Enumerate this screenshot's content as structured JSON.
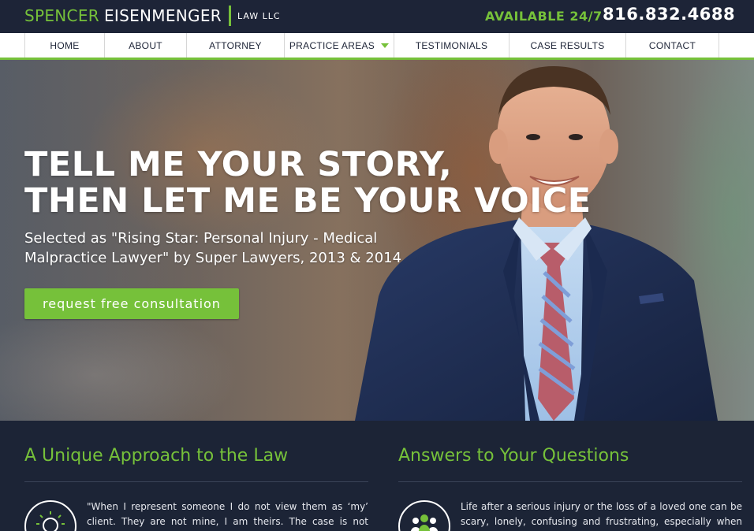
{
  "header": {
    "logo_first": "SPENCER",
    "logo_last": "EISENMENGER",
    "logo_suffix": "LAW LLC",
    "availability": "AVAILABLE 24/7",
    "phone": "816.832.4688"
  },
  "nav": {
    "items": [
      {
        "label": "HOME"
      },
      {
        "label": "ABOUT"
      },
      {
        "label": "ATTORNEY"
      },
      {
        "label": "PRACTICE AREAS"
      },
      {
        "label": "TESTIMONIALS"
      },
      {
        "label": "CASE RESULTS"
      },
      {
        "label": "CONTACT"
      }
    ]
  },
  "hero": {
    "headline_line1": "TELL ME YOUR STORY,",
    "headline_line2": "THEN LET ME BE YOUR VOICE",
    "subhead": "Selected as \"Rising Star: Personal Injury - Medical Malpractice Lawyer\" by Super Lawyers, 2013 & 2014",
    "cta_label": "request free consultation"
  },
  "sections": {
    "approach": {
      "title": "A Unique Approach to the Law",
      "icon": "lightbulb-icon",
      "text": "\"When I represent someone I do not view them as ‘my’ client. They are not mine, I am theirs. The case is not about me, it is about"
    },
    "answers": {
      "title": "Answers to Your Questions",
      "icon": "people-group-icon",
      "text": "Life after a serious injury or the loss of a loved one can be scary, lonely, confusing and frustrating, especially when dealing with"
    }
  },
  "colors": {
    "brand_green": "#76c13a",
    "navy": "#1d2437"
  }
}
